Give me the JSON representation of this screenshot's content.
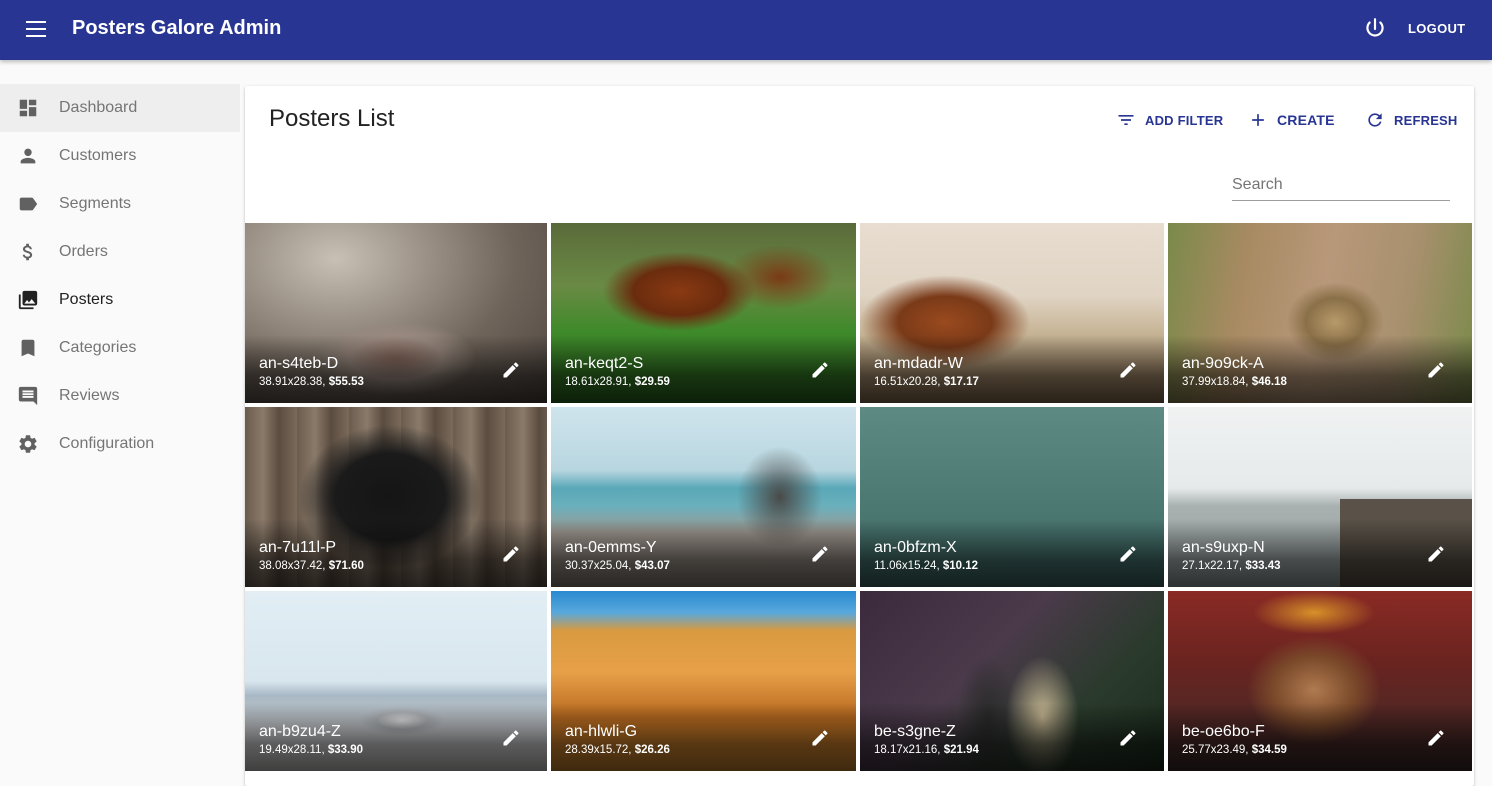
{
  "app": {
    "title": "Posters Galore Admin",
    "logout_label": "LOGOUT"
  },
  "sidebar": {
    "items": [
      {
        "label": "Dashboard",
        "icon": "dashboard-icon"
      },
      {
        "label": "Customers",
        "icon": "person-icon"
      },
      {
        "label": "Segments",
        "icon": "label-icon"
      },
      {
        "label": "Orders",
        "icon": "dollar-icon"
      },
      {
        "label": "Posters",
        "icon": "collections-icon"
      },
      {
        "label": "Categories",
        "icon": "bookmark-icon"
      },
      {
        "label": "Reviews",
        "icon": "comment-icon"
      },
      {
        "label": "Configuration",
        "icon": "settings-icon"
      }
    ],
    "selected": "Posters"
  },
  "list": {
    "title": "Posters List",
    "actions": {
      "add_filter": "ADD FILTER",
      "create": "CREATE",
      "refresh": "REFRESH"
    },
    "search": {
      "placeholder": "Search",
      "value": ""
    }
  },
  "posters": [
    {
      "reference": "an-s4teb-D",
      "size": "38.91x28.38,",
      "price": "$55.53"
    },
    {
      "reference": "an-keqt2-S",
      "size": "18.61x28.91,",
      "price": "$29.59"
    },
    {
      "reference": "an-mdadr-W",
      "size": "16.51x20.28,",
      "price": "$17.17"
    },
    {
      "reference": "an-9o9ck-A",
      "size": "37.99x18.84,",
      "price": "$46.18"
    },
    {
      "reference": "an-7u11l-P",
      "size": "38.08x37.42,",
      "price": "$71.60"
    },
    {
      "reference": "an-0emms-Y",
      "size": "30.37x25.04,",
      "price": "$43.07"
    },
    {
      "reference": "an-0bfzm-X",
      "size": "11.06x15.24,",
      "price": "$10.12"
    },
    {
      "reference": "an-s9uxp-N",
      "size": "27.1x22.17,",
      "price": "$33.43"
    },
    {
      "reference": "an-b9zu4-Z",
      "size": "19.49x28.11,",
      "price": "$33.90"
    },
    {
      "reference": "an-hlwli-G",
      "size": "28.39x15.72,",
      "price": "$26.26"
    },
    {
      "reference": "be-s3gne-Z",
      "size": "18.17x21.16,",
      "price": "$21.94"
    },
    {
      "reference": "be-oe6bo-F",
      "size": "25.77x23.49,",
      "price": "$34.59"
    }
  ],
  "colors": {
    "primary": "#283593",
    "background": "#fafafa"
  }
}
